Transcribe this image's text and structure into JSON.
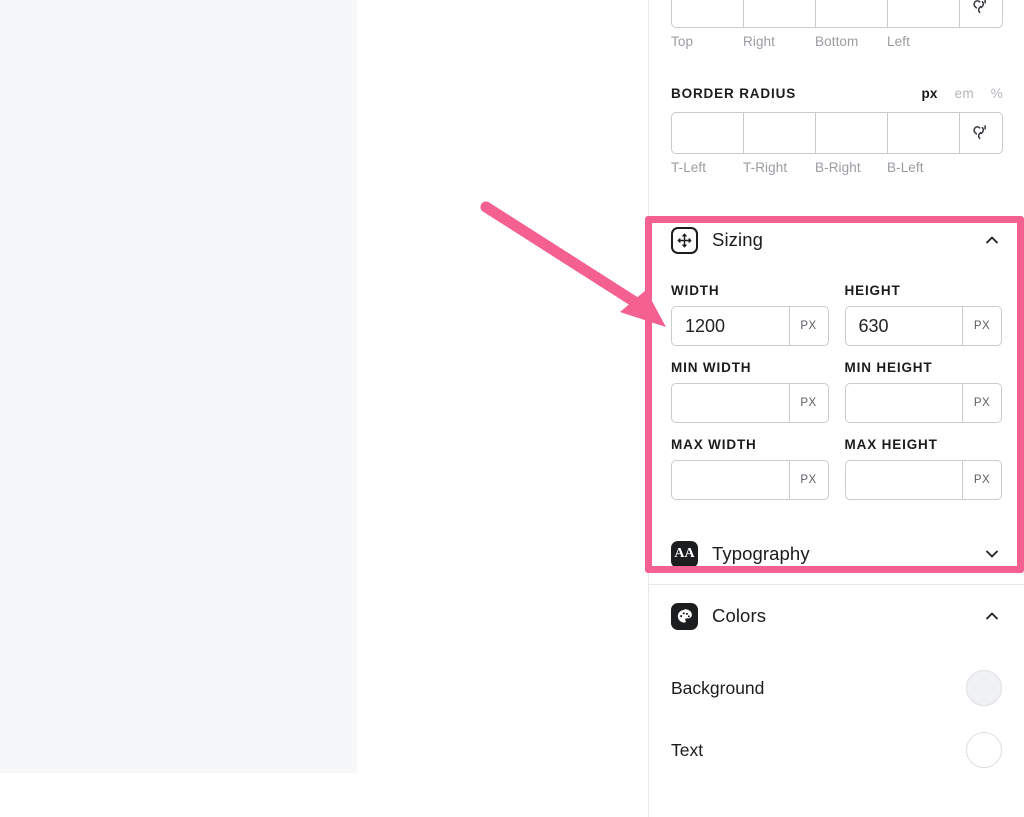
{
  "panel": {
    "spacing_block": {
      "sub_labels": [
        "Top",
        "Right",
        "Bottom",
        "Left"
      ],
      "link_icon": "broken-link-icon"
    },
    "border_radius_block": {
      "caption": "BORDER RADIUS",
      "units": [
        {
          "label": "px",
          "active": true
        },
        {
          "label": "em",
          "active": false
        },
        {
          "label": "%",
          "active": false
        }
      ],
      "sub_labels": [
        "T-Left",
        "T-Right",
        "B-Right",
        "B-Left"
      ],
      "link_icon": "broken-link-icon"
    },
    "sizing": {
      "title": "Sizing",
      "icon": "move-arrows-icon",
      "chevron": "chevron-up-icon",
      "expanded": true,
      "fields": [
        {
          "label": "WIDTH",
          "value": "1200",
          "unit": "PX",
          "icon": ""
        },
        {
          "label": "HEIGHT",
          "value": "630",
          "unit": "PX",
          "icon": ""
        },
        {
          "label": "MIN WIDTH",
          "value": "",
          "unit": "PX",
          "icon": ""
        },
        {
          "label": "MIN HEIGHT",
          "value": "",
          "unit": "PX",
          "icon": ""
        },
        {
          "label": "MAX WIDTH",
          "value": "",
          "unit": "PX",
          "icon": "globe-icon"
        },
        {
          "label": "MAX HEIGHT",
          "value": "",
          "unit": "PX",
          "icon": ""
        }
      ]
    },
    "typography": {
      "title": "Typography",
      "icon": "typography-aa-icon",
      "chevron": "chevron-down-icon",
      "expanded": false
    },
    "colors": {
      "title": "Colors",
      "icon": "color-palette-icon",
      "chevron": "chevron-up-icon",
      "expanded": true,
      "rows": [
        {
          "label": "Background",
          "swatch": "#eff1f4",
          "empty": false
        },
        {
          "label": "Text",
          "swatch": "",
          "empty": true
        }
      ]
    }
  },
  "annotation": {
    "highlight_color": "#f4608f",
    "shapes": [
      "highlight-rectangle",
      "pointer-arrow"
    ]
  }
}
